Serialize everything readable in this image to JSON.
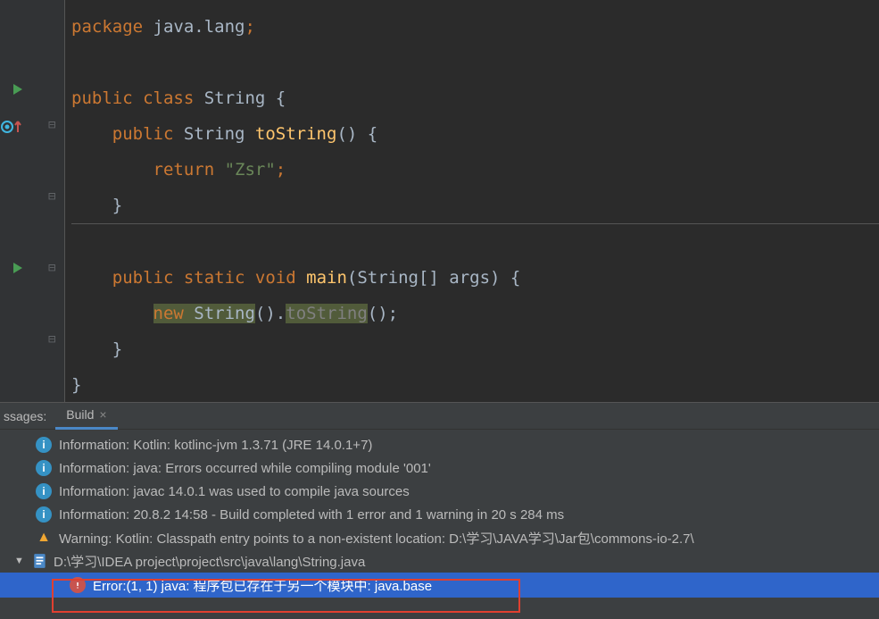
{
  "code": {
    "line1_package": "package",
    "line1_pkg": " java.lang",
    "line1_semi": ";",
    "line3_public": "public",
    "line3_class": " class",
    "line3_name": " String ",
    "line3_brace": "{",
    "line4_public": "public",
    "line4_type": " String ",
    "line4_method": "toString",
    "line4_parens": "() {",
    "line5_return": "return",
    "line5_str": " \"Zsr\"",
    "line5_semi": ";",
    "line6_close": "}",
    "line8_public": "public",
    "line8_static": " static",
    "line8_void": " void",
    "line8_main": " main",
    "line8_args": "(String[] args) {",
    "line9_new": "new",
    "line9_type": " String",
    "line9_parens": "().",
    "line9_call": "toString",
    "line9_end": "();",
    "line10_close": "}",
    "line11_close": "}"
  },
  "panel": {
    "messages_label": "ssages:",
    "build_tab": "Build"
  },
  "messages": [
    {
      "type": "info",
      "text": "Information: Kotlin: kotlinc-jvm 1.3.71 (JRE 14.0.1+7)"
    },
    {
      "type": "info",
      "text": "Information: java: Errors occurred while compiling module '001'"
    },
    {
      "type": "info",
      "text": "Information: javac 14.0.1 was used to compile java sources"
    },
    {
      "type": "info",
      "text": "Information: 20.8.2 14:58 - Build completed with 1 error and 1 warning in 20 s 284 ms"
    },
    {
      "type": "warn",
      "text": "Warning: Kotlin: Classpath entry points to a non-existent location: D:\\学习\\JAVA学习\\Jar包\\commons-io-2.7\\"
    }
  ],
  "file_node": "D:\\学习\\IDEA project\\project\\src\\java\\lang\\String.java",
  "error_msg": "Error:(1, 1)  java: 程序包已存在于另一个模块中: java.base"
}
